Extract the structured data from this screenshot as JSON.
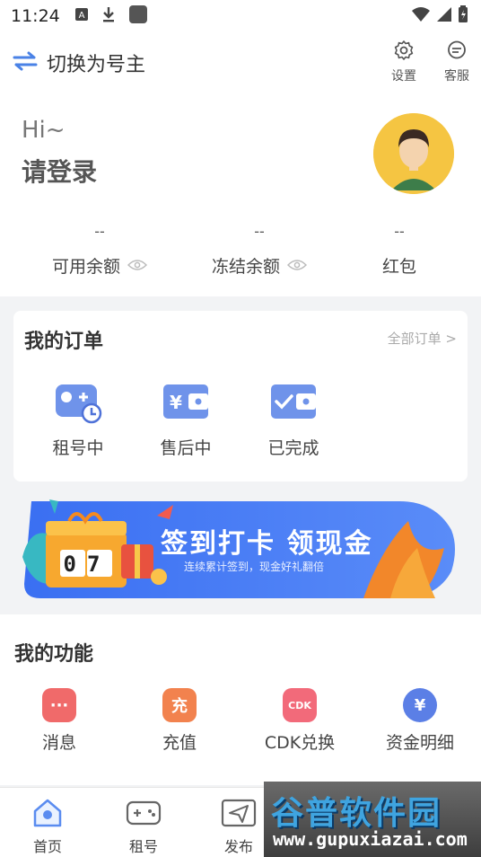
{
  "status_bar": {
    "time": "11:24"
  },
  "topbar": {
    "switch_label": "切换为号主",
    "settings_label": "设置",
    "service_label": "客服"
  },
  "profile": {
    "greeting": "Hi~",
    "login_prompt": "请登录",
    "stats": [
      {
        "value": "--",
        "label": "可用余额"
      },
      {
        "value": "--",
        "label": "冻结余额"
      },
      {
        "value": "--",
        "label": "红包"
      }
    ]
  },
  "orders": {
    "title": "我的订单",
    "all_link": "全部订单 >",
    "items": [
      {
        "label": "租号中",
        "icon": "gamepad-clock-icon"
      },
      {
        "label": "售后中",
        "icon": "wallet-yen-icon"
      },
      {
        "label": "已完成",
        "icon": "wallet-check-icon"
      }
    ]
  },
  "banner": {
    "title": "签到打卡 领现金",
    "subtitle": "连续累计签到，现金好礼翻倍",
    "counter": "07"
  },
  "functions": {
    "title": "我的功能",
    "items": [
      {
        "label": "消息",
        "icon": "message-icon",
        "glyph": "···",
        "color": "#f06a6a"
      },
      {
        "label": "充值",
        "icon": "recharge-icon",
        "glyph": "充",
        "color": "#f2824e"
      },
      {
        "label": "CDK兑换",
        "icon": "cdk-icon",
        "glyph": "CDK",
        "color": "#f26a7a"
      },
      {
        "label": "资金明细",
        "icon": "fund-detail-icon",
        "glyph": "¥",
        "color": "#5b7fe6"
      }
    ]
  },
  "tabbar": {
    "items": [
      {
        "label": "首页",
        "icon": "home-icon"
      },
      {
        "label": "租号",
        "icon": "gamepad-icon"
      },
      {
        "label": "发布",
        "icon": "send-icon"
      }
    ]
  },
  "watermark": {
    "brand": "谷普软件园",
    "url": "www.gupuxiazai.com"
  }
}
